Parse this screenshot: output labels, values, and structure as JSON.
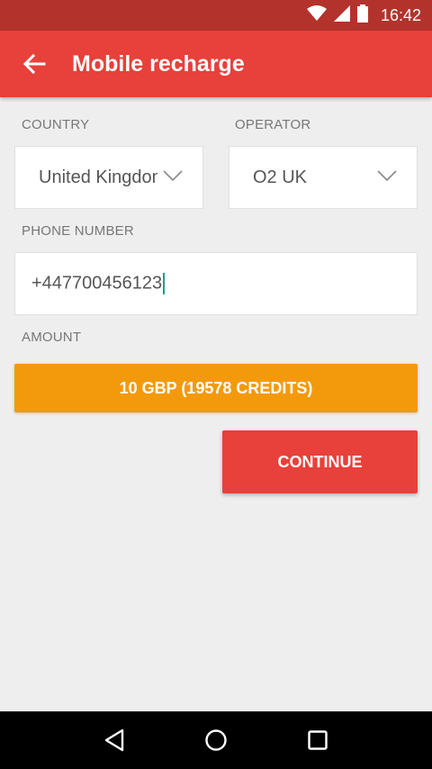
{
  "status_bar": {
    "time": "16:42"
  },
  "app_bar": {
    "title": "Mobile recharge"
  },
  "form": {
    "country": {
      "label": "COUNTRY",
      "value": "United Kingdom"
    },
    "operator": {
      "label": "OPERATOR",
      "value": "O2 UK"
    },
    "phone": {
      "label": "PHONE NUMBER",
      "value": "+447700456123"
    },
    "amount": {
      "label": "AMOUNT",
      "value": "10 GBP (19578 CREDITS)"
    }
  },
  "actions": {
    "continue_label": "CONTINUE"
  },
  "colors": {
    "status_bar": "#b3332c",
    "app_bar": "#e8403a",
    "amount_button": "#f39a0c",
    "continue_button": "#e8403a",
    "background": "#eeeeee"
  }
}
